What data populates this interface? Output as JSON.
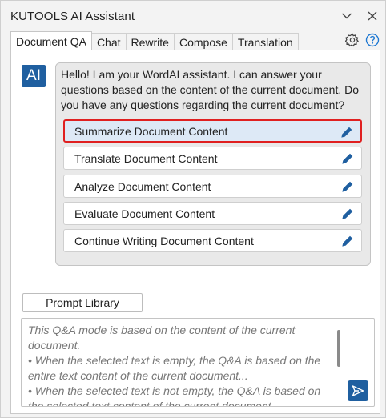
{
  "window": {
    "title": "KUTOOLS AI Assistant",
    "collapse_icon": "chevron-down-icon",
    "close_icon": "close-icon"
  },
  "tabs": [
    {
      "label": "Document QA",
      "active": true
    },
    {
      "label": "Chat",
      "active": false
    },
    {
      "label": "Rewrite",
      "active": false
    },
    {
      "label": "Compose",
      "active": false
    },
    {
      "label": "Translation",
      "active": false
    }
  ],
  "toolbar": {
    "settings_icon": "gear-icon",
    "help_icon": "help-icon"
  },
  "assistant": {
    "avatar_label": "AI",
    "greeting": "Hello! I am your WordAI assistant. I can answer your questions based on the content of the current document. Do you have any questions regarding the current document?",
    "suggestions": [
      {
        "label": "Summarize Document Content",
        "selected": true
      },
      {
        "label": "Translate Document Content",
        "selected": false
      },
      {
        "label": "Analyze Document Content",
        "selected": false
      },
      {
        "label": "Evaluate Document Content",
        "selected": false
      },
      {
        "label": "Continue Writing Document Content",
        "selected": false
      }
    ],
    "edit_icon": "pencil-icon"
  },
  "prompt_library": {
    "label": "Prompt Library"
  },
  "input": {
    "placeholder": "This Q&A mode is based on the content of the current document.\n• When the selected text is empty, the Q&A is based on the entire text content of the current document...\n• When the selected text is not empty, the Q&A is based on the selected text content of the current document...",
    "send_icon": "send-icon"
  },
  "colors": {
    "accent": "#1f5fa0",
    "selection_border": "#e02020",
    "selection_fill": "#dde9f6",
    "help": "#1e78d2"
  }
}
